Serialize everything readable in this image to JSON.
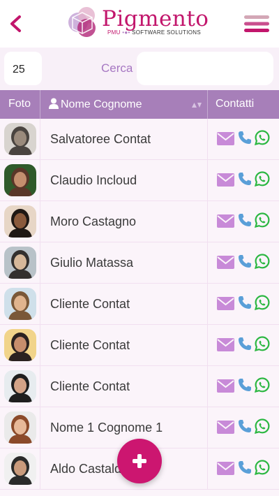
{
  "header": {
    "logo_text": "Pigmento",
    "logo_sub_pmu": "PMU",
    "logo_sub_rest": "SOFTWARE SOLUTIONS"
  },
  "controls": {
    "page_size": "25",
    "search_label": "Cerca",
    "search_value": ""
  },
  "table": {
    "columns": [
      "Foto",
      "Nome Cognome",
      "Contatti"
    ],
    "rows": [
      {
        "name": "Salvatoree Contat"
      },
      {
        "name": "Claudio Incloud"
      },
      {
        "name": "Moro Castagno"
      },
      {
        "name": "Giulio Matassa"
      },
      {
        "name": "Cliente Contat"
      },
      {
        "name": "Cliente Contat"
      },
      {
        "name": "Cliente Contat"
      },
      {
        "name": "Nome 1 Cognome 1"
      },
      {
        "name": "Aldo Castaldo"
      }
    ]
  },
  "colors": {
    "brand": "#c2166c",
    "header_row": "#a77fb9",
    "mail_icon": "#c88ad8",
    "phone_icon": "#5a9fd8",
    "whatsapp_icon": "#2cb742",
    "fab": "#cc1670"
  },
  "icons": [
    "back-chevron-icon",
    "menu-icon",
    "user-icon",
    "sort-icon",
    "mail-icon",
    "phone-icon",
    "whatsapp-icon",
    "plus-icon"
  ]
}
